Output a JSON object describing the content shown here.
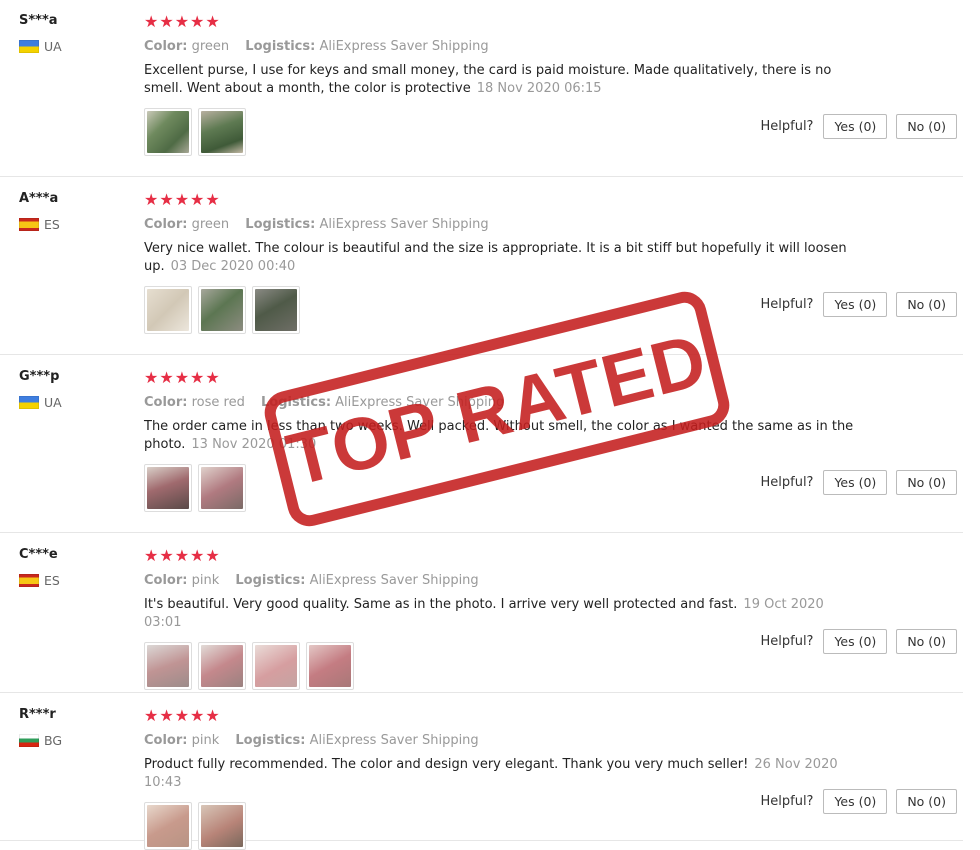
{
  "labels": {
    "color": "Color:",
    "logistics": "Logistics:",
    "helpful": "Helpful?"
  },
  "stamp": {
    "text": "TOP RATED",
    "color": "#c41e1e"
  },
  "star_color": "#e62e45",
  "reviews": [
    {
      "user": "S***a",
      "country": "UA",
      "stars": "★★★★★",
      "color": "green",
      "logistics": "AliExpress Saver Shipping",
      "text": "Excellent purse, I use for keys and small money, the card is paid moisture. Made qualitatively, there is no smell. Went about a month, the color is protective",
      "date": "18 Nov 2020 06:15",
      "yes": "Yes (0)",
      "no": "No (0)"
    },
    {
      "user": "A***a",
      "country": "ES",
      "stars": "★★★★★",
      "color": "green",
      "logistics": "AliExpress Saver Shipping",
      "text": "Very nice wallet. The colour is beautiful and the size is appropriate. It is a bit stiff but hopefully it will loosen up.",
      "date": "03 Dec 2020 00:40",
      "yes": "Yes (0)",
      "no": "No (0)"
    },
    {
      "user": "G***p",
      "country": "UA",
      "stars": "★★★★★",
      "color": "rose red",
      "logistics": "AliExpress Saver Shipping",
      "text": "The order came in less than two weeks. Well packed. Without smell, the color as I wanted the same as in the photo.",
      "date": "13 Nov 2020 01:30",
      "yes": "Yes (0)",
      "no": "No (0)"
    },
    {
      "user": "C***e",
      "country": "ES",
      "stars": "★★★★★",
      "color": "pink",
      "logistics": "AliExpress Saver Shipping",
      "text": "It's beautiful. Very good quality. Same as in the photo. I arrive very well protected and fast.",
      "date": "19 Oct 2020 03:01",
      "yes": "Yes (0)",
      "no": "No (0)"
    },
    {
      "user": "R***r",
      "country": "BG",
      "stars": "★★★★★",
      "color": "pink",
      "logistics": "AliExpress Saver Shipping",
      "text": "Product fully recommended. The color and design very elegant. Thank you very much seller!",
      "date": "26 Nov 2020 10:43",
      "yes": "Yes (0)",
      "no": "No (0)"
    }
  ]
}
